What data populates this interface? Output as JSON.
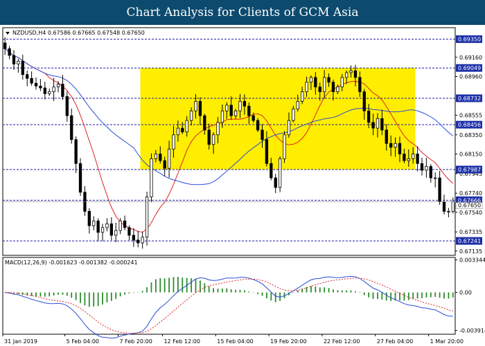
{
  "banner_title": "Chart Analysis for Clients of GCM Asia",
  "chart_data": [
    {
      "type": "candlestick",
      "header": "NZDUSD,H4  0.67586 0.67665 0.67548 0.67650",
      "y_ticks": [
        "0.69160",
        "0.68960",
        "0.68555",
        "0.68350",
        "0.68150",
        "0.67945",
        "0.67740",
        "0.67540",
        "0.67335",
        "0.67135"
      ],
      "levels": [
        {
          "label": "0.69350",
          "value": 0.6935
        },
        {
          "label": "0.69049",
          "value": 0.69049
        },
        {
          "label": "0.68732",
          "value": 0.68732
        },
        {
          "label": "0.68456",
          "value": 0.68456
        },
        {
          "label": "0.67987",
          "value": 0.67987
        },
        {
          "label": "0.67666",
          "value": 0.67666
        },
        {
          "label": "0.67241",
          "value": 0.67241
        }
      ],
      "current_price": "0.67650",
      "zone": {
        "from_index": 31,
        "to_index": 92,
        "low": 0.67987,
        "high": 0.69049
      },
      "ylim": [
        0.6709,
        0.6947
      ],
      "x_ticks": [
        {
          "label": "31 Jan 2019",
          "index": 0
        },
        {
          "label": "5 Feb 04:00",
          "index": 14
        },
        {
          "label": "7 Feb 20:00",
          "index": 26
        },
        {
          "label": "12 Feb 12:00",
          "index": 36
        },
        {
          "label": "15 Feb 04:00",
          "index": 48
        },
        {
          "label": "19 Feb 20:00",
          "index": 60
        },
        {
          "label": "22 Feb 12:00",
          "index": 72
        },
        {
          "label": "27 Feb 04:00",
          "index": 84
        },
        {
          "label": "1 Mar 20:00",
          "index": 96
        }
      ],
      "closes": [
        0.6925,
        0.6918,
        0.6909,
        0.6912,
        0.6898,
        0.6894,
        0.6889,
        0.6886,
        0.6884,
        0.6878,
        0.688,
        0.6885,
        0.6888,
        0.6875,
        0.6855,
        0.683,
        0.6805,
        0.6775,
        0.6755,
        0.674,
        0.6745,
        0.6733,
        0.6738,
        0.6742,
        0.673,
        0.6735,
        0.6745,
        0.6738,
        0.673,
        0.6725,
        0.6722,
        0.6728,
        0.677,
        0.681,
        0.6815,
        0.6808,
        0.68,
        0.682,
        0.6835,
        0.6842,
        0.6838,
        0.685,
        0.686,
        0.687,
        0.6855,
        0.684,
        0.6825,
        0.6835,
        0.6848,
        0.686,
        0.6866,
        0.6855,
        0.686,
        0.687,
        0.6865,
        0.6855,
        0.685,
        0.684,
        0.683,
        0.6805,
        0.679,
        0.678,
        0.681,
        0.6835,
        0.685,
        0.6862,
        0.687,
        0.688,
        0.689,
        0.6895,
        0.6885,
        0.688,
        0.6895,
        0.689,
        0.688,
        0.6885,
        0.6895,
        0.69,
        0.6902,
        0.6895,
        0.688,
        0.686,
        0.6848,
        0.6842,
        0.6852,
        0.684,
        0.6826,
        0.6822,
        0.6826,
        0.6815,
        0.6808,
        0.681,
        0.6815,
        0.6805,
        0.6798,
        0.6802,
        0.679,
        0.679,
        0.6765,
        0.6755,
        0.6755,
        0.6765
      ],
      "indicator_lines": [
        {
          "name": "red",
          "color": "#dd2222",
          "period": 10
        },
        {
          "name": "blue",
          "color": "#2a4bd8",
          "period": 30
        }
      ]
    },
    {
      "type": "macd",
      "label": "MACD(12,26,9) -0.001623 -0.001382 -0.000241",
      "y_ticks": [
        {
          "label": "0.003344",
          "value": 0.003344
        },
        {
          "label": "0.00",
          "value": 0.0
        },
        {
          "label": "-0.003914",
          "value": -0.003914
        }
      ],
      "ylim": [
        -0.0043,
        0.0036
      ]
    }
  ]
}
